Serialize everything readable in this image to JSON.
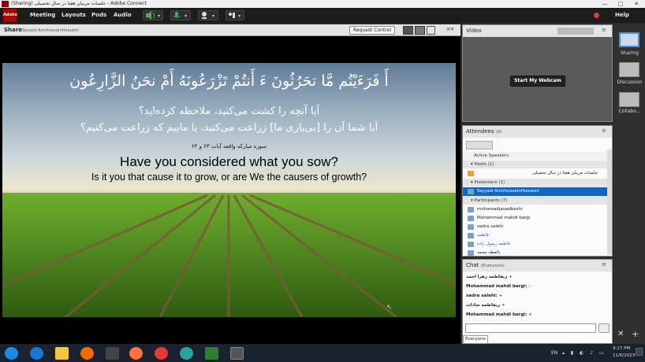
{
  "window": {
    "title": "(Sharing) جلسات مربیان هفتا در سال تحصیلی - Adobe Connect",
    "minimize": "—",
    "maximize": "□",
    "close": "✕"
  },
  "menubar": {
    "items": [
      "Meeting",
      "Layouts",
      "Pods",
      "Audio"
    ],
    "help": "Help"
  },
  "share": {
    "title": "Share",
    "presenter": "Seyyed AmirhosseinHosseini",
    "request_control": "Request Control"
  },
  "slide": {
    "arabic_verse": "أَ فَرَءَيْتُم مَّا تحَرُثُونَ ءَ أَنتُمْ تَزْرَعُونَهُ أَمْ نحَنُ الزَّارِعُون",
    "persian_line1": "آیا آنچه را کشت می‌کنید، ملاحظه کرده‌اید؟",
    "persian_line2": "آیا شما آن را [بی‌یاری ما] زراعت می‌کنید، یا ماییم که زراعت می‌کنیم؟",
    "reference": "سوره مبارکه واقعه آیات ۶۳ و ۶۴",
    "english_line1": "Have you considered what you sow?",
    "english_line2": "Is it you that cause it to grow, or are We the causers of growth?"
  },
  "video": {
    "title": "Video",
    "start_webcam": "Start My Webcam"
  },
  "attendees": {
    "title": "Attendees",
    "count": "(9)",
    "active_speakers": "Active Speakers",
    "hosts_label": "Hosts (1)",
    "host_name": "جلسات مربیان هفتا در سال تحصیلی",
    "presenters_label": "Presenters (1)",
    "presenter_name": "Seyyed AmirhosseinHosseini",
    "participants_label": "Participants (7)",
    "participants": [
      "mohamadjavadbashi",
      "Mohammad mahdi bargi",
      "sadra salehi",
      "فاطمه",
      "فاطمه رسول زاده",
      "یالفظه محمد"
    ]
  },
  "chat": {
    "title": "Chat",
    "scope": "(Everyone)",
    "messages": [
      {
        "sender": "زیفاطمه زهرا احمد",
        "text": "+"
      },
      {
        "sender": "Mohammad mahdi bargi:",
        "text": "::"
      },
      {
        "sender": "sadra salehi:",
        "text": "+"
      },
      {
        "sender": "زیفاطمه سادات",
        "text": "+"
      },
      {
        "sender": "Mohammad mahdi bargi:",
        "text": "+"
      }
    ],
    "tab": "Everyone",
    "input_placeholder": ""
  },
  "layouts": {
    "items": [
      "Sharing",
      "Discussion",
      "Collabo..."
    ]
  },
  "taskbar": {
    "lang": "EN",
    "time": "9:17 PM",
    "date": "11/6/2023"
  },
  "colors": {
    "accent_selected": "#1565c0",
    "dark_bg": "#1c1c1c",
    "record_red": "#e53935"
  }
}
